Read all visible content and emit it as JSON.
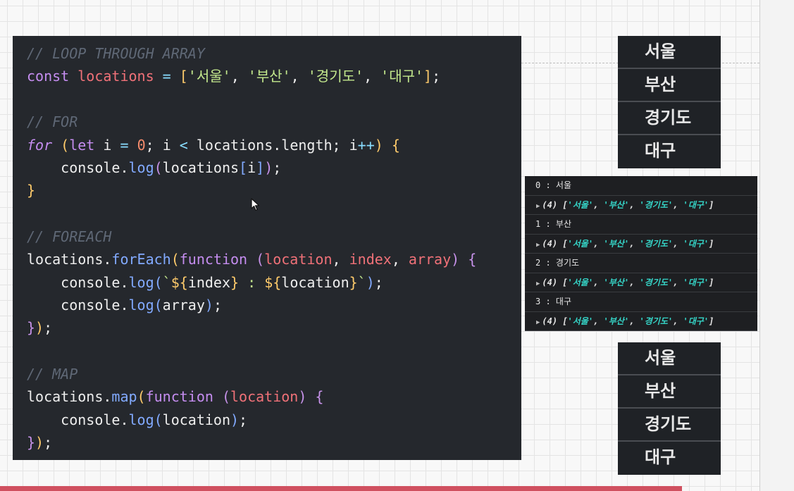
{
  "editor": {
    "lines": [
      [
        {
          "t": "// LOOP THROUGH ARRAY",
          "c": "cm"
        }
      ],
      [
        {
          "t": "const ",
          "c": "kw"
        },
        {
          "t": "locations",
          "c": "var"
        },
        {
          "t": " = ",
          "c": "op"
        },
        {
          "t": "[",
          "c": "br"
        },
        {
          "t": "'서울'",
          "c": "str"
        },
        {
          "t": ", ",
          "c": "plain"
        },
        {
          "t": "'부산'",
          "c": "str"
        },
        {
          "t": ", ",
          "c": "plain"
        },
        {
          "t": "'경기도'",
          "c": "str"
        },
        {
          "t": ", ",
          "c": "plain"
        },
        {
          "t": "'대구'",
          "c": "str"
        },
        {
          "t": "]",
          "c": "br"
        },
        {
          "t": ";",
          "c": "plain"
        }
      ],
      [],
      [
        {
          "t": "// FOR",
          "c": "cm"
        }
      ],
      [
        {
          "t": "for",
          "c": "kwi"
        },
        {
          "t": " (",
          "c": "br"
        },
        {
          "t": "let",
          "c": "kw"
        },
        {
          "t": " i ",
          "c": "plain"
        },
        {
          "t": "=",
          "c": "op"
        },
        {
          "t": " ",
          "c": "plain"
        },
        {
          "t": "0",
          "c": "num"
        },
        {
          "t": "; i ",
          "c": "plain"
        },
        {
          "t": "<",
          "c": "op"
        },
        {
          "t": " locations.length; i",
          "c": "plain"
        },
        {
          "t": "++",
          "c": "op"
        },
        {
          "t": ") {",
          "c": "br"
        }
      ],
      [
        {
          "t": "    console.",
          "c": "plain"
        },
        {
          "t": "log",
          "c": "fn"
        },
        {
          "t": "(",
          "c": "br2"
        },
        {
          "t": "locations",
          "c": "plain"
        },
        {
          "t": "[",
          "c": "br3"
        },
        {
          "t": "i",
          "c": "plain"
        },
        {
          "t": "]",
          "c": "br3"
        },
        {
          "t": ")",
          "c": "br2"
        },
        {
          "t": ";",
          "c": "plain"
        }
      ],
      [
        {
          "t": "}",
          "c": "br"
        }
      ],
      [],
      [
        {
          "t": "// FOREACH",
          "c": "cm"
        }
      ],
      [
        {
          "t": "locations.",
          "c": "plain"
        },
        {
          "t": "forEach",
          "c": "fn"
        },
        {
          "t": "(",
          "c": "br"
        },
        {
          "t": "function",
          "c": "kw"
        },
        {
          "t": " (",
          "c": "br2"
        },
        {
          "t": "location",
          "c": "var"
        },
        {
          "t": ", ",
          "c": "plain"
        },
        {
          "t": "index",
          "c": "var"
        },
        {
          "t": ", ",
          "c": "plain"
        },
        {
          "t": "array",
          "c": "var"
        },
        {
          "t": ") {",
          "c": "br2"
        }
      ],
      [
        {
          "t": "    console.",
          "c": "plain"
        },
        {
          "t": "log",
          "c": "fn"
        },
        {
          "t": "(",
          "c": "br3"
        },
        {
          "t": "`",
          "c": "str"
        },
        {
          "t": "${",
          "c": "br"
        },
        {
          "t": "index",
          "c": "plain"
        },
        {
          "t": "}",
          "c": "br"
        },
        {
          "t": " : ",
          "c": "str"
        },
        {
          "t": "${",
          "c": "br"
        },
        {
          "t": "location",
          "c": "plain"
        },
        {
          "t": "}",
          "c": "br"
        },
        {
          "t": "`",
          "c": "str"
        },
        {
          "t": ")",
          "c": "br3"
        },
        {
          "t": ";",
          "c": "plain"
        }
      ],
      [
        {
          "t": "    console.",
          "c": "plain"
        },
        {
          "t": "log",
          "c": "fn"
        },
        {
          "t": "(",
          "c": "br3"
        },
        {
          "t": "array",
          "c": "plain"
        },
        {
          "t": ")",
          "c": "br3"
        },
        {
          "t": ";",
          "c": "plain"
        }
      ],
      [
        {
          "t": "}",
          "c": "br2"
        },
        {
          "t": ")",
          "c": "br"
        },
        {
          "t": ";",
          "c": "plain"
        }
      ],
      [],
      [
        {
          "t": "// MAP",
          "c": "cm"
        }
      ],
      [
        {
          "t": "locations.",
          "c": "plain"
        },
        {
          "t": "map",
          "c": "fn"
        },
        {
          "t": "(",
          "c": "br"
        },
        {
          "t": "function",
          "c": "kw"
        },
        {
          "t": " (",
          "c": "br2"
        },
        {
          "t": "location",
          "c": "var"
        },
        {
          "t": ") {",
          "c": "br2"
        }
      ],
      [
        {
          "t": "    console.",
          "c": "plain"
        },
        {
          "t": "log",
          "c": "fn"
        },
        {
          "t": "(",
          "c": "br3"
        },
        {
          "t": "location",
          "c": "plain"
        },
        {
          "t": ")",
          "c": "br3"
        },
        {
          "t": ";",
          "c": "plain"
        }
      ],
      [
        {
          "t": "}",
          "c": "br2"
        },
        {
          "t": ")",
          "c": "br"
        },
        {
          "t": ";",
          "c": "plain"
        }
      ]
    ]
  },
  "list_top": {
    "items": [
      "서울",
      "부산",
      "경기도",
      "대구"
    ]
  },
  "list_bottom": {
    "items": [
      "서울",
      "부산",
      "경기도",
      "대구"
    ]
  },
  "console": {
    "rows": [
      {
        "kind": "log",
        "text": "0 : 서울"
      },
      {
        "kind": "array",
        "prefix": "(4) [",
        "items": [
          "'서울'",
          "'부산'",
          "'경기도'",
          "'대구'"
        ],
        "suffix": "]"
      },
      {
        "kind": "log",
        "text": "1 : 부산"
      },
      {
        "kind": "array",
        "prefix": "(4) [",
        "items": [
          "'서울'",
          "'부산'",
          "'경기도'",
          "'대구'"
        ],
        "suffix": "]"
      },
      {
        "kind": "log",
        "text": "2 : 경기도"
      },
      {
        "kind": "array",
        "prefix": "(4) [",
        "items": [
          "'서울'",
          "'부산'",
          "'경기도'",
          "'대구'"
        ],
        "suffix": "]"
      },
      {
        "kind": "log",
        "text": "3 : 대구"
      },
      {
        "kind": "array",
        "prefix": "(4) [",
        "items": [
          "'서울'",
          "'부산'",
          "'경기도'",
          "'대구'"
        ],
        "suffix": "]"
      }
    ]
  }
}
